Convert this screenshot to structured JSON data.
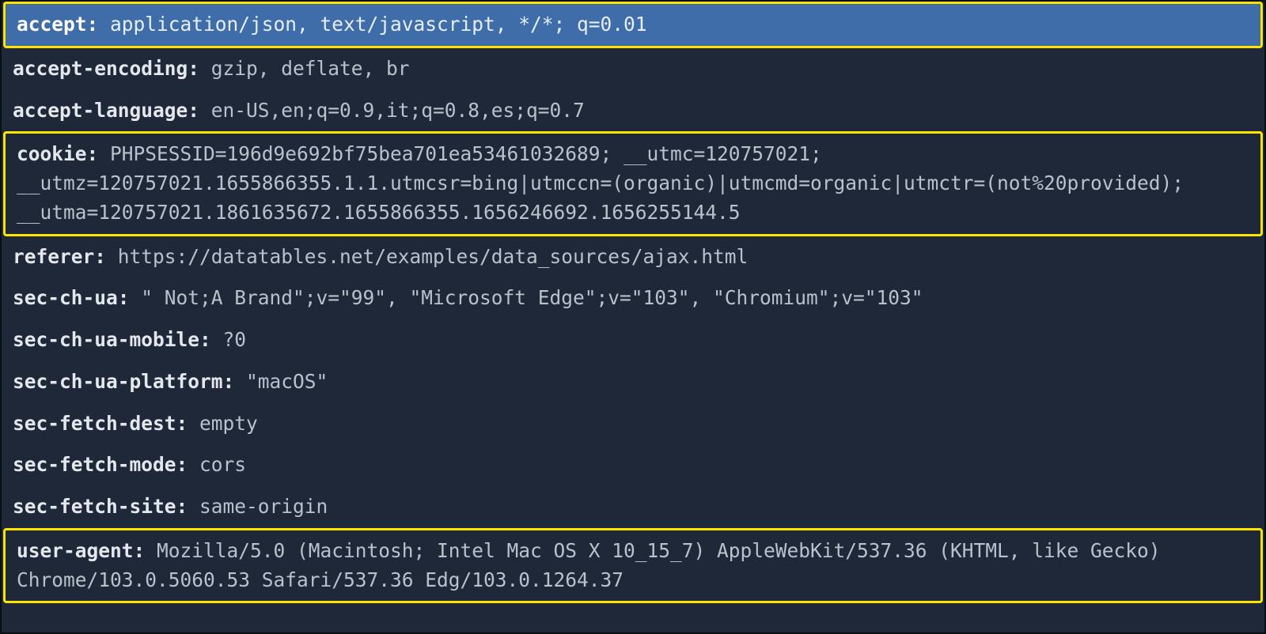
{
  "headers": [
    {
      "name": "accept",
      "value": "application/json, text/javascript, */*; q=0.01",
      "selected": true,
      "highlighted": true
    },
    {
      "name": "accept-encoding",
      "value": "gzip, deflate, br",
      "selected": false,
      "highlighted": false
    },
    {
      "name": "accept-language",
      "value": "en-US,en;q=0.9,it;q=0.8,es;q=0.7",
      "selected": false,
      "highlighted": false
    },
    {
      "name": "cookie",
      "value": "PHPSESSID=196d9e692bf75bea701ea53461032689; __utmc=120757021; __utmz=120757021.1655866355.1.1.utmcsr=bing|utmccn=(organic)|utmcmd=organic|utmctr=(not%20provided); __utma=120757021.1861635672.1655866355.1656246692.1656255144.5",
      "selected": false,
      "highlighted": true
    },
    {
      "name": "referer",
      "value": "https://datatables.net/examples/data_sources/ajax.html",
      "selected": false,
      "highlighted": false
    },
    {
      "name": "sec-ch-ua",
      "value": "\" Not;A Brand\";v=\"99\", \"Microsoft Edge\";v=\"103\", \"Chromium\";v=\"103\"",
      "selected": false,
      "highlighted": false
    },
    {
      "name": "sec-ch-ua-mobile",
      "value": "?0",
      "selected": false,
      "highlighted": false
    },
    {
      "name": "sec-ch-ua-platform",
      "value": "\"macOS\"",
      "selected": false,
      "highlighted": false
    },
    {
      "name": "sec-fetch-dest",
      "value": "empty",
      "selected": false,
      "highlighted": false
    },
    {
      "name": "sec-fetch-mode",
      "value": "cors",
      "selected": false,
      "highlighted": false
    },
    {
      "name": "sec-fetch-site",
      "value": "same-origin",
      "selected": false,
      "highlighted": false
    },
    {
      "name": "user-agent",
      "value": "Mozilla/5.0 (Macintosh; Intel Mac OS X 10_15_7) AppleWebKit/537.36 (KHTML, like Gecko) Chrome/103.0.5060.53 Safari/537.36 Edg/103.0.1264.37",
      "selected": false,
      "highlighted": true
    }
  ]
}
